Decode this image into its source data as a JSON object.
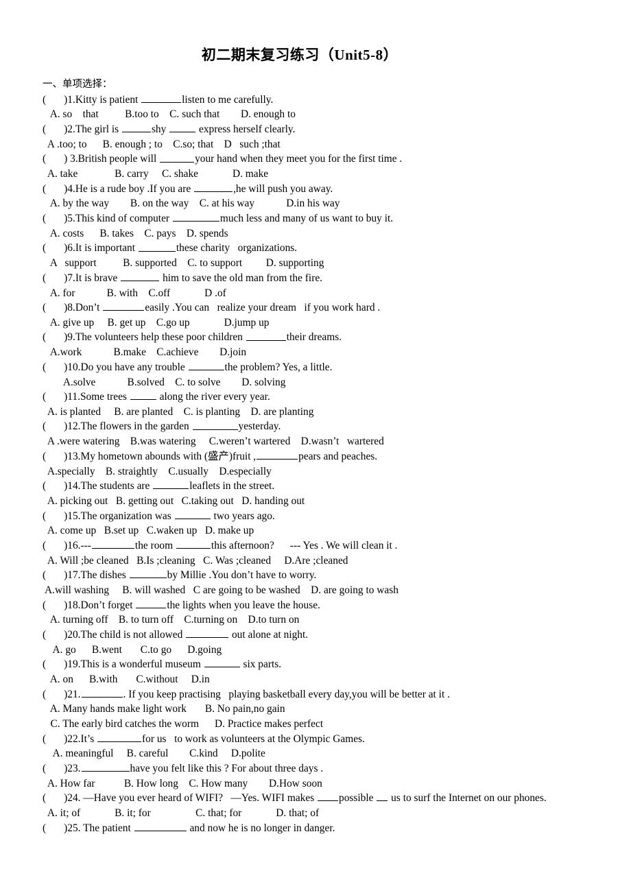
{
  "document": {
    "title": "初二期末复习练习（Unit5-8）",
    "section_heading": "一、单项选择："
  },
  "questions": [
    {
      "marker_open": "(",
      "marker_close": ")",
      "number": "1.",
      "stem_before": "Kitty is patient ",
      "blank1_width": 58,
      "stem_after": "listen to me carefully.",
      "options_lines": [
        "   A. so    that          B.too to    C. such that        D. enough to"
      ]
    },
    {
      "marker_open": "(",
      "marker_close": ")",
      "number": "2.",
      "stem_before": "The girl is ",
      "blank1_width": 42,
      "stem_mid": "shy ",
      "blank2_width": 38,
      "stem_after": " express herself clearly.",
      "options_lines": [
        "  A .too; to      B. enough ; to    C.so; that    D   such ;that"
      ]
    },
    {
      "marker_open": "(",
      "marker_close": ")",
      "number": " 3.",
      "stem_before": "British people will ",
      "blank1_width": 50,
      "stem_after": "your hand when they meet you for the first time .",
      "options_lines": [
        "  A. take              B. carry     C. shake             D. make"
      ]
    },
    {
      "marker_open": "(",
      "marker_close": ")",
      "number": "4.",
      "stem_before": "He is a rude boy .If you are ",
      "blank1_width": 56,
      "stem_after": ",he will push you away.",
      "options_lines": [
        "   A. by the way        B. on the way    C. at his way            D.in his way"
      ]
    },
    {
      "marker_open": "(",
      "marker_close": ")",
      "number": "5.",
      "stem_before": "This kind of computer ",
      "blank1_width": 68,
      "stem_after": "much less and many of us want to buy it.",
      "options_lines": [
        "   A. costs      B. takes    C. pays    D. spends"
      ]
    },
    {
      "marker_open": "(",
      "marker_close": ")",
      "number": "6.",
      "stem_before": "It is important ",
      "blank1_width": 54,
      "stem_after": "these charity   organizations.",
      "options_lines": [
        "   A   support          B. supported    C. to support         D. supporting"
      ]
    },
    {
      "marker_open": "(",
      "marker_close": ")",
      "number": "7.",
      "stem_before": "It is brave ",
      "blank1_width": 56,
      "stem_after": " him to save the old man from the fire.",
      "options_lines": [
        "   A. for            B. with    C.off             D .of"
      ]
    },
    {
      "marker_open": "(",
      "marker_close": ")",
      "number": "8.",
      "stem_before": "Don’t ",
      "blank1_width": 60,
      "stem_after": "easily .You can   realize your dream   if you work hard .",
      "options_lines": [
        "   A. give up     B. get up    C.go up             D.jump up"
      ]
    },
    {
      "marker_open": "(",
      "marker_close": ")",
      "number": "9.",
      "stem_before": "The volunteers help these poor children ",
      "blank1_width": 58,
      "stem_after": "their dreams.",
      "options_lines": [
        "   A.work            B.make    C.achieve        D.join"
      ]
    },
    {
      "marker_open": "(",
      "marker_close": ")",
      "number": "10.",
      "stem_before": "Do you have any trouble ",
      "blank1_width": 52,
      "stem_after": "the problem? Yes, a little.",
      "options_lines": [
        "        A.solve            B.solved    C. to solve        D. solving"
      ]
    },
    {
      "marker_open": "(",
      "marker_close": ")",
      "number": "11.",
      "stem_before": "Some trees ",
      "blank1_width": 38,
      "stem_after": " along the river every year.",
      "options_lines": [
        "  A. is planted     B. are planted    C. is planting    D. are planting"
      ]
    },
    {
      "marker_open": "(",
      "marker_close": ")",
      "number": "12.",
      "stem_before": "The flowers in the garden ",
      "blank1_width": 66,
      "stem_after": "yesterday.",
      "options_lines": [
        "  A .were watering    B.was watering     C.weren’t wartered    D.wasn’t   wartered"
      ]
    },
    {
      "marker_open": "(",
      "marker_close": ")",
      "number": "13.",
      "stem_before": "My hometown abounds with (盛产)fruit ,",
      "blank1_width": 60,
      "stem_after": "pears and peaches.",
      "options_lines": [
        "  A.specially    B. straightly    C.usually    D.especially"
      ]
    },
    {
      "marker_open": "(",
      "marker_close": ")",
      "number": "14.",
      "stem_before": "The students are ",
      "blank1_width": 52,
      "stem_after": "leaflets in the street.",
      "options_lines": [
        "  A. picking out   B. getting out   C.taking out   D. handing out"
      ]
    },
    {
      "marker_open": "(",
      "marker_close": ")",
      "number": "15.",
      "stem_before": "The organization was ",
      "blank1_width": 52,
      "stem_after": " two years ago.",
      "options_lines": [
        "  A. come up   B.set up   C.waken up   D. make up"
      ]
    },
    {
      "marker_open": "(",
      "marker_close": ")",
      "number": "16.",
      "stem_before": "---",
      "blank1_width": 62,
      "stem_mid": "the room ",
      "blank2_width": 50,
      "stem_after": "this afternoon?      --- Yes . We will clean it .",
      "options_lines": [
        "  A. Will ;be cleaned   B.Is ;cleaning   C. Was ;cleaned     D.Are ;cleaned"
      ]
    },
    {
      "marker_open": "(",
      "marker_close": ")",
      "number": "17.",
      "stem_before": "The dishes ",
      "blank1_width": 54,
      "stem_after": "by Millie .You don’t have to worry.",
      "options_lines": [
        " A.will washing     B. will washed   C are going to be washed    D. are going to wash"
      ]
    },
    {
      "marker_open": "(",
      "marker_close": ")",
      "number": "18.",
      "stem_before": "Don’t forget ",
      "blank1_width": 44,
      "stem_after": "the lights when you leave the house.",
      "options_lines": [
        "   A. turning off    B. to turn off    C.turning on    D.to turn on"
      ]
    },
    {
      "marker_open": "(",
      "marker_close": ")",
      "number": "20.",
      "stem_before": "The child is not allowed ",
      "blank1_width": 62,
      "stem_after": " out alone at night.",
      "options_lines": [
        "    A. go      B.went       C.to go      D.going"
      ]
    },
    {
      "marker_open": "(",
      "marker_close": ")",
      "number": "19.",
      "stem_before": "This is a wonderful museum ",
      "blank1_width": 52,
      "stem_after": " six parts.",
      "options_lines": [
        "   A. on      B.with       C.without     D.in"
      ]
    },
    {
      "marker_open": "(",
      "marker_close": ")",
      "number": "21.",
      "stem_before": "",
      "blank1_width": 60,
      "stem_after": ". If you keep practising   playing basketball every day,you will be better at it .",
      "options_lines": [
        "   A. Many hands make light work       B. No pain,no gain",
        "   C. The early bird catches the worm      D. Practice makes perfect"
      ]
    },
    {
      "marker_open": "(",
      "marker_close": ")",
      "number": "22.",
      "stem_before": "It’s ",
      "blank1_width": 64,
      "stem_after": "for us   to work as volunteers at the Olympic Games.",
      "options_lines": [
        "    A. meaningful     B. careful        C.kind     D.polite"
      ]
    },
    {
      "marker_open": "(",
      "marker_close": ")",
      "number": "23.",
      "stem_before": "",
      "blank1_width": 70,
      "stem_after": "have you felt like this ? For about three days .",
      "options_lines": [
        "  A. How far           B. How long    C. How many        D.How soon"
      ]
    },
    {
      "marker_open": "(",
      "marker_close": ")",
      "number": "24.",
      "stem_before": " —Have you ever heard of WIFI?   —Yes. WIFI makes ",
      "blank1_width": 30,
      "stem_mid": "possible ",
      "blank2_width": 16,
      "stem_after": " us to surf the Internet on our phones.",
      "options_lines": [
        "  A. it; of             B. it; for                 C. that; for             D. that; of"
      ]
    },
    {
      "marker_open": "(",
      "marker_close": ")",
      "number": "25.",
      "stem_before": " The patient ",
      "blank1_width": 76,
      "stem_after": " and now he is no longer in danger.",
      "options_lines": []
    }
  ]
}
